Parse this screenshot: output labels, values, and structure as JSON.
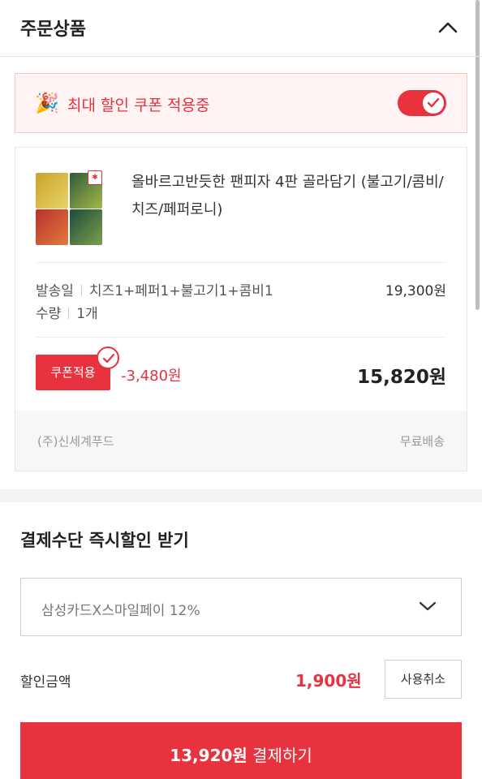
{
  "header": {
    "title": "주문상품"
  },
  "coupon_banner": {
    "emoji": "🎉",
    "label": "최대 할인 쿠폰 적용중",
    "toggle_on": true
  },
  "product": {
    "name": "올바르고반듯한 팬피자 4판 골라담기 (불고기/콤비/치즈/페퍼로니)",
    "ship_date_label": "발송일",
    "option": "치즈1+페퍼1+불고기1+콤비1",
    "qty_label": "수량",
    "qty": "1개",
    "price": "19,300원",
    "coupon_label": "쿠폰적용",
    "discount": "-3,480원",
    "final_price": "15,820원",
    "seller": "(주)신세계푸드",
    "shipping": "무료배송"
  },
  "payment": {
    "title": "결제수단 즉시할인 받기",
    "card_option": "삼성카드X스마일페이 12%",
    "discount_label": "할인금액",
    "discount_amount": "1,900원",
    "cancel_label": "사용취소",
    "pay_amount": "13,920원",
    "pay_label": "결제하기"
  },
  "colors": {
    "accent": "#e8333f",
    "accent_text": "#e5333f",
    "banner_bg": "#fff3f3"
  }
}
